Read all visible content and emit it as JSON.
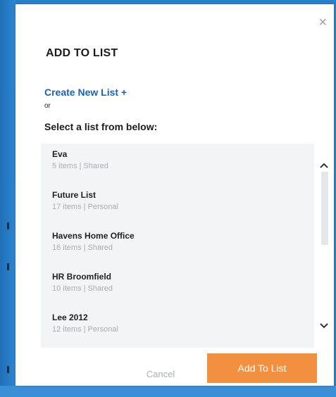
{
  "modal": {
    "title": "ADD TO LIST",
    "create_link": "Create New List +",
    "or_text": "or",
    "select_label": "Select a list from below:",
    "close_glyph": "×"
  },
  "lists": [
    {
      "name": "Eva",
      "meta": "5 items | Shared"
    },
    {
      "name": "Future List",
      "meta": "17 items | Personal"
    },
    {
      "name": "Havens Home Office",
      "meta": "16 items | Shared"
    },
    {
      "name": "HR Broomfield",
      "meta": "10 items | Shared"
    },
    {
      "name": "Lee 2012",
      "meta": "12 items | Personal"
    }
  ],
  "footer": {
    "cancel_label": "Cancel",
    "add_label": "Add To List"
  },
  "colors": {
    "accent": "#f3903f",
    "link": "#1565b8"
  },
  "icons": {
    "close": "close-icon",
    "scroll_up": "chevron-up-icon",
    "scroll_down": "chevron-down-icon"
  }
}
